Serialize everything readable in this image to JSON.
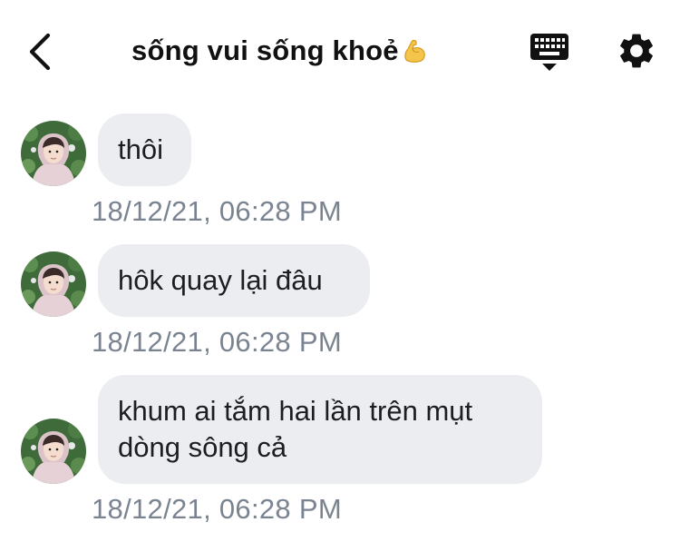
{
  "header": {
    "back_icon": "chevron-left-icon",
    "title": "sống vui sống khoẻ",
    "title_emoji": "flexed-biceps-emoji",
    "keyboard_icon": "keyboard-icon",
    "settings_icon": "gear-icon"
  },
  "messages": [
    {
      "lines": [
        "thôi"
      ],
      "timestamp": "18/12/21, 06:28 PM"
    },
    {
      "lines": [
        "hôk quay lại đâu"
      ],
      "timestamp": "18/12/21, 06:28 PM"
    },
    {
      "lines": [
        "khum ai tắm hai lần trên mụt",
        "dòng sông cả"
      ],
      "timestamp": "18/12/21, 06:28 PM"
    }
  ],
  "colors": {
    "bubble_bg": "#ebedf0",
    "timestamp": "#7a8491",
    "title": "#111111"
  }
}
